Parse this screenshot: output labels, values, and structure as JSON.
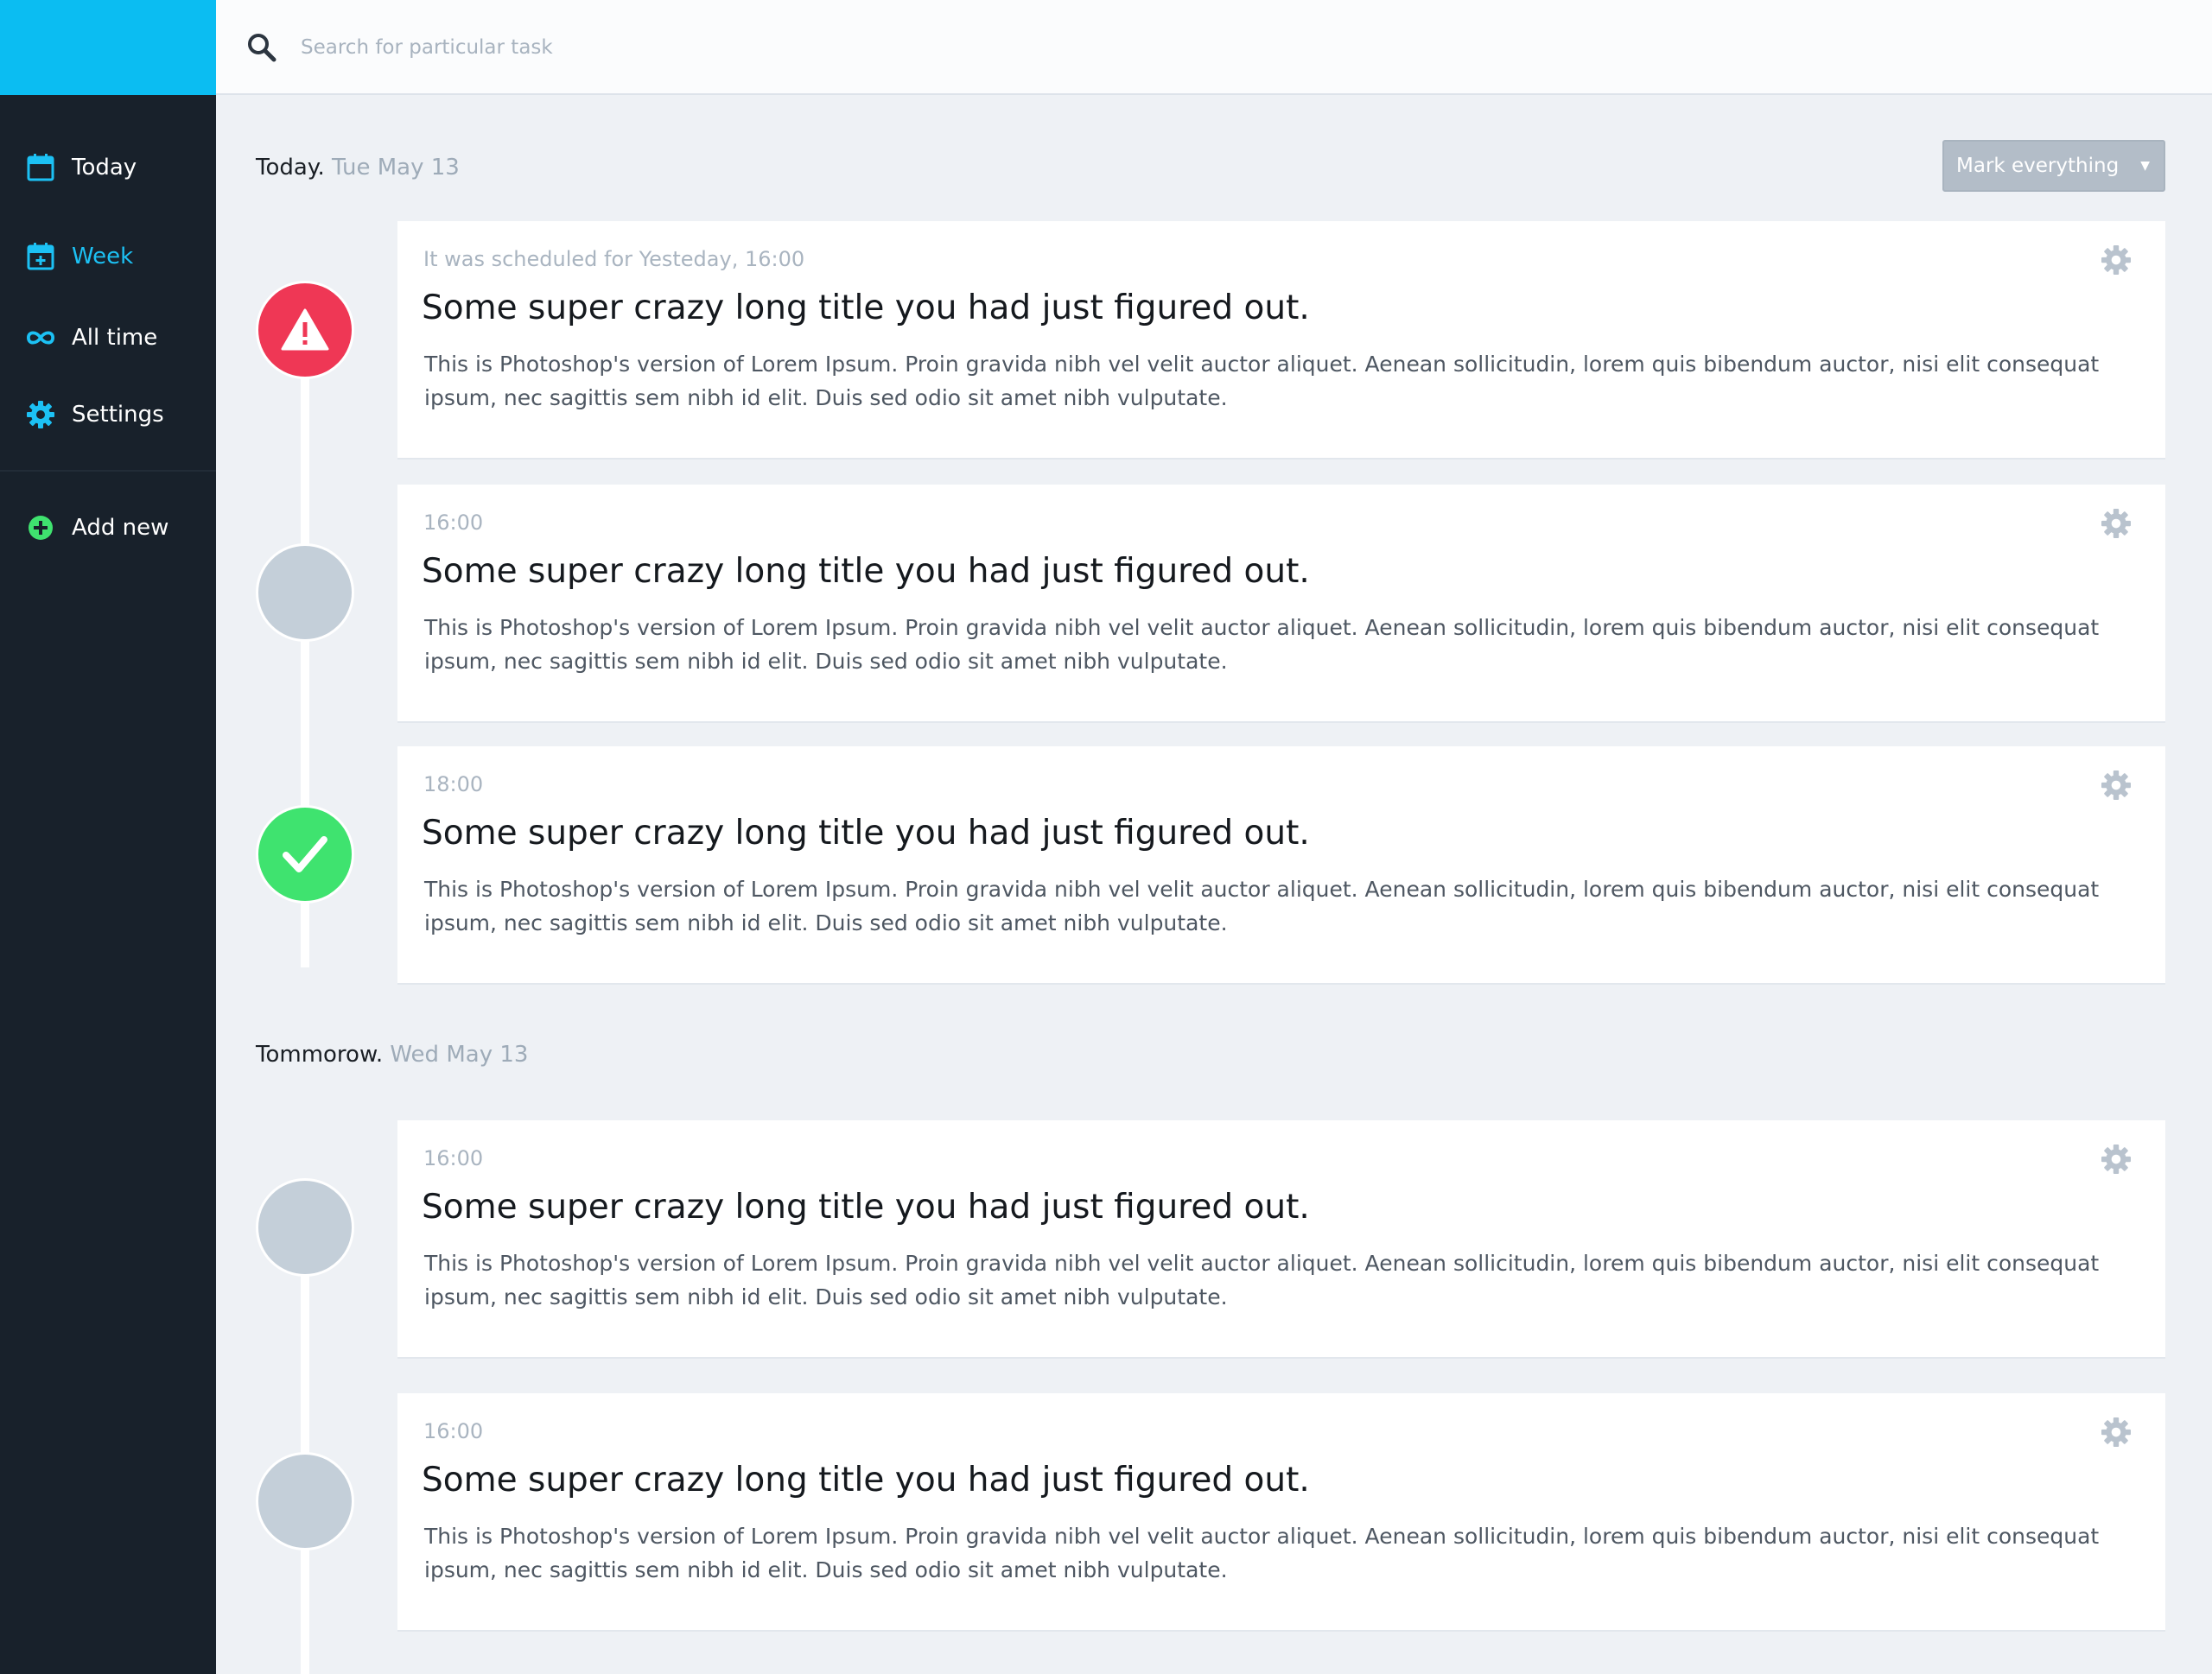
{
  "search": {
    "placeholder": "Search for particular task"
  },
  "sidebar": {
    "items": [
      {
        "label": "Today",
        "icon": "calendar-icon"
      },
      {
        "label": "Week",
        "icon": "calendar-add-icon",
        "active": true
      },
      {
        "label": "All time",
        "icon": "infinity-icon"
      },
      {
        "label": "Settings",
        "icon": "gear-icon"
      }
    ],
    "add_new": {
      "label": "Add new",
      "icon": "plus-circle-icon"
    }
  },
  "toolbar": {
    "mark_label": "Mark everything",
    "mark_caret": "▼"
  },
  "sections": [
    {
      "label": "Today.",
      "date": "Tue May 13",
      "tasks": [
        {
          "time": "It was scheduled for Yesteday, 16:00",
          "title": "Some super crazy long title you had just figured out.",
          "description": "This is Photoshop's version  of Lorem Ipsum. Proin gravida nibh vel velit auctor aliquet. Aenean sollicitudin, lorem quis bibendum auctor, nisi elit consequat ipsum, nec sagittis sem nibh id elit. Duis sed odio sit amet nibh vulputate.",
          "status": "overdue"
        },
        {
          "time": "16:00",
          "title": "Some super crazy long title you had just figured out.",
          "description": "This is Photoshop's version  of Lorem Ipsum. Proin gravida nibh vel velit auctor aliquet. Aenean sollicitudin, lorem quis bibendum auctor, nisi elit consequat ipsum, nec sagittis sem nibh id elit. Duis sed odio sit amet nibh vulputate.",
          "status": "pending"
        },
        {
          "time": "18:00",
          "title": "Some super crazy long title you had just figured out.",
          "description": "This is Photoshop's version  of Lorem Ipsum. Proin gravida nibh vel velit auctor aliquet. Aenean sollicitudin, lorem quis bibendum auctor, nisi elit consequat ipsum, nec sagittis sem nibh id elit. Duis sed odio sit amet nibh vulputate.",
          "status": "done"
        }
      ]
    },
    {
      "label": "Tommorow.",
      "date": "Wed May 13",
      "tasks": [
        {
          "time": "16:00",
          "title": "Some super crazy long title you had just figured out.",
          "description": "This is Photoshop's version  of Lorem Ipsum. Proin gravida nibh vel velit auctor aliquet. Aenean sollicitudin, lorem quis bibendum auctor, nisi elit consequat ipsum, nec sagittis sem nibh id elit. Duis sed odio sit amet nibh vulputate.",
          "status": "pending"
        },
        {
          "time": "16:00",
          "title": "Some super crazy long title you had just figured out.",
          "description": "This is Photoshop's version  of Lorem Ipsum. Proin gravida nibh vel velit auctor aliquet. Aenean sollicitudin, lorem quis bibendum auctor, nisi elit consequat ipsum, nec sagittis sem nibh id elit. Duis sed odio sit amet nibh vulputate.",
          "status": "pending"
        }
      ]
    }
  ],
  "colors": {
    "brand": "#0bbdf2",
    "sidebar": "#18212b",
    "active": "#1cc1f4",
    "overdue": "#ef3755",
    "done": "#3fe36f",
    "pending": "#c4cfd9",
    "add": "#3fe36f"
  }
}
